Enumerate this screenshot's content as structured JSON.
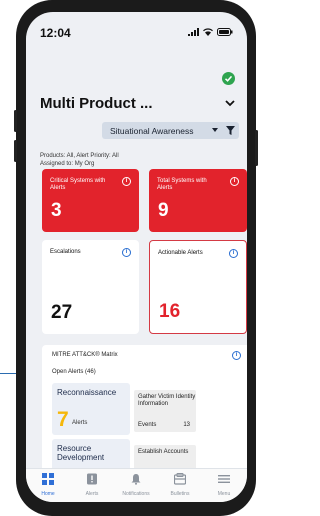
{
  "status_bar": {
    "time": "12:04"
  },
  "header": {
    "title": "Multi Product ...",
    "view_dropdown": "Situational Awareness"
  },
  "filters_summary": {
    "line1": "Products: All, Alert Priority: All",
    "line2": "Assigned to: My Org"
  },
  "cards": [
    {
      "label": "Critical Systems with Alerts",
      "value": "3"
    },
    {
      "label": "Total Systems with Alerts",
      "value": "9"
    },
    {
      "label": "Escalations",
      "value": "27"
    },
    {
      "label": "Actionable Alerts",
      "value": "16"
    }
  ],
  "mitre": {
    "title": "MITRE ATT&CK® Matrix",
    "open_alerts": "Open Alerts (46)",
    "tactics": [
      {
        "name": "Reconnaissance",
        "count": "7",
        "unit": "Alerts",
        "technique": {
          "name": "Gather Victim Identity Information",
          "events_label": "Events",
          "events_count": "13"
        }
      },
      {
        "name": "Resource Development",
        "technique": {
          "name": "Establish Accounts"
        }
      }
    ]
  },
  "nav": [
    {
      "label": "Home",
      "icon": "home-icon",
      "active": true
    },
    {
      "label": "Alerts",
      "icon": "alert-icon"
    },
    {
      "label": "Notifications",
      "icon": "bell-icon"
    },
    {
      "label": "Bulletins",
      "icon": "bulletin-icon"
    },
    {
      "label": "Menu",
      "icon": "menu-icon"
    }
  ],
  "colors": {
    "alert_red": "#e2232c",
    "accent_blue": "#2f6fd6",
    "status_green": "#2ea44f",
    "tactic_count_yellow": "#f5b70a"
  }
}
